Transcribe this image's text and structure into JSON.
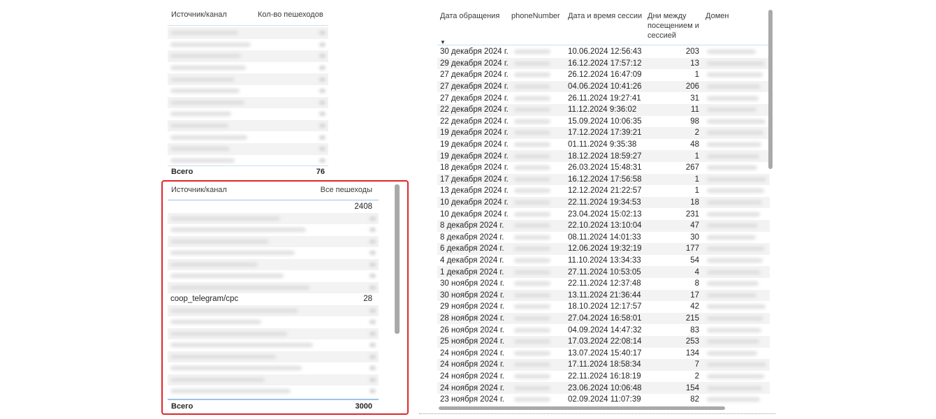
{
  "table1": {
    "col_source": "Источник/канал",
    "col_count": "Кол-во пешеходов",
    "blurred_rows": 12,
    "total_label": "Всего",
    "total_value": "76"
  },
  "table2": {
    "col_source": "Источник/канал",
    "col_all": "Все пешеходы",
    "first_value": "2408",
    "blurred_before": 7,
    "highlight_source": "coop_telegram/cpc",
    "highlight_value": "28",
    "blurred_after": 8,
    "total_label": "Всего",
    "total_value": "3000"
  },
  "table3": {
    "col_date": "Дата обращения",
    "col_phone": "phoneNumber",
    "col_session": "Дата и время сессии",
    "col_days": "Дни между посещением и сессией",
    "col_domain": "Домен",
    "sort_indicator": "▼",
    "rows": [
      {
        "date": "30 декабря 2024 г.",
        "session": "10.06.2024 12:56:43",
        "days": "203"
      },
      {
        "date": "29 декабря 2024 г.",
        "session": "16.12.2024 17:57:12",
        "days": "13"
      },
      {
        "date": "27 декабря 2024 г.",
        "session": "26.12.2024 16:47:09",
        "days": "1"
      },
      {
        "date": "27 декабря 2024 г.",
        "session": "04.06.2024 10:41:26",
        "days": "206"
      },
      {
        "date": "27 декабря 2024 г.",
        "session": "26.11.2024 19:27:41",
        "days": "31"
      },
      {
        "date": "22 декабря 2024 г.",
        "session": "11.12.2024 9:36:02",
        "days": "11"
      },
      {
        "date": "22 декабря 2024 г.",
        "session": "15.09.2024 10:06:35",
        "days": "98"
      },
      {
        "date": "19 декабря 2024 г.",
        "session": "17.12.2024 17:39:21",
        "days": "2"
      },
      {
        "date": "19 декабря 2024 г.",
        "session": "01.11.2024 9:35:38",
        "days": "48"
      },
      {
        "date": "19 декабря 2024 г.",
        "session": "18.12.2024 18:59:27",
        "days": "1"
      },
      {
        "date": "18 декабря 2024 г.",
        "session": "26.03.2024 15:48:31",
        "days": "267"
      },
      {
        "date": "17 декабря 2024 г.",
        "session": "16.12.2024 17:56:58",
        "days": "1"
      },
      {
        "date": "13 декабря 2024 г.",
        "session": "12.12.2024 21:22:57",
        "days": "1"
      },
      {
        "date": "10 декабря 2024 г.",
        "session": "22.11.2024 19:34:53",
        "days": "18"
      },
      {
        "date": "10 декабря 2024 г.",
        "session": "23.04.2024 15:02:13",
        "days": "231"
      },
      {
        "date": "8 декабря 2024 г.",
        "session": "22.10.2024 13:10:04",
        "days": "47"
      },
      {
        "date": "8 декабря 2024 г.",
        "session": "08.11.2024 14:01:33",
        "days": "30"
      },
      {
        "date": "6 декабря 2024 г.",
        "session": "12.06.2024 19:32:19",
        "days": "177"
      },
      {
        "date": "4 декабря 2024 г.",
        "session": "11.10.2024 13:34:33",
        "days": "54"
      },
      {
        "date": "1 декабря 2024 г.",
        "session": "27.11.2024 10:53:05",
        "days": "4"
      },
      {
        "date": "30 ноября 2024 г.",
        "session": "22.11.2024 12:37:48",
        "days": "8"
      },
      {
        "date": "30 ноября 2024 г.",
        "session": "13.11.2024 21:36:44",
        "days": "17"
      },
      {
        "date": "29 ноября 2024 г.",
        "session": "18.10.2024 12:17:57",
        "days": "42"
      },
      {
        "date": "28 ноября 2024 г.",
        "session": "27.04.2024 16:58:01",
        "days": "215"
      },
      {
        "date": "26 ноября 2024 г.",
        "session": "04.09.2024 14:47:32",
        "days": "83"
      },
      {
        "date": "25 ноября 2024 г.",
        "session": "17.03.2024 22:08:14",
        "days": "253"
      },
      {
        "date": "24 ноября 2024 г.",
        "session": "13.07.2024 15:40:17",
        "days": "134"
      },
      {
        "date": "24 ноября 2024 г.",
        "session": "17.11.2024 18:58:34",
        "days": "7"
      },
      {
        "date": "24 ноября 2024 г.",
        "session": "22.11.2024 16:18:19",
        "days": "2"
      },
      {
        "date": "24 ноября 2024 г.",
        "session": "23.06.2024 10:06:48",
        "days": "154"
      },
      {
        "date": "23 ноября 2024 г.",
        "session": "02.09.2024 11:07:39",
        "days": "82"
      }
    ]
  },
  "colors": {
    "highlight_border": "#e0262a",
    "header_line": "#9dc5e6",
    "row_stripe": "#f3f3f3",
    "scrollbar": "#a9a9a9"
  }
}
